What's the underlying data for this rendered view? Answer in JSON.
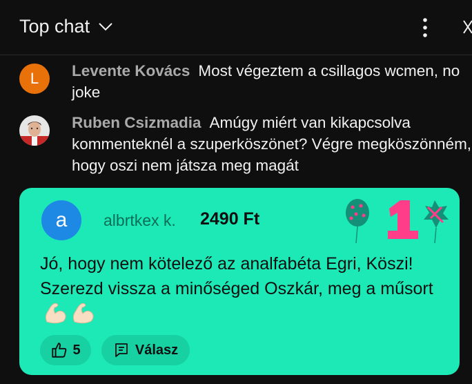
{
  "header": {
    "title": "Top chat",
    "chevron_icon": "chevron-down-icon",
    "menu_icon": "more-vertical-icon",
    "close_icon": "close-icon"
  },
  "messages": [
    {
      "author": "Levente Kovács",
      "text": "Most végeztem a csillagos wcmen, no joke",
      "avatar_letter": "L",
      "avatar_color": "#e8710a"
    },
    {
      "author": "Ruben Csizmadia",
      "text": "Amúgy miért van kikapcsolva kommenteknél a szuperköszönet? Végre megköszönném, hogy oszi nem játsza meg magát",
      "avatar_icon": "user-photo-avatar"
    }
  ],
  "super_chat": {
    "avatar_letter": "a",
    "avatar_color": "#1e88e5",
    "author": "albrtkex k.",
    "amount": "2490 Ft",
    "text": "Jó, hogy nem kötelező az analfabéta Egri, Köszi! Szerezd vissza a minőséged Oszkár, meg a műsort",
    "background_color": "#1de9b6",
    "decoration_icon": "balloon-one-celebration-icon",
    "emoji_icon": "flexed-biceps-icon",
    "like_count": "5",
    "reply_label": "Válasz"
  }
}
